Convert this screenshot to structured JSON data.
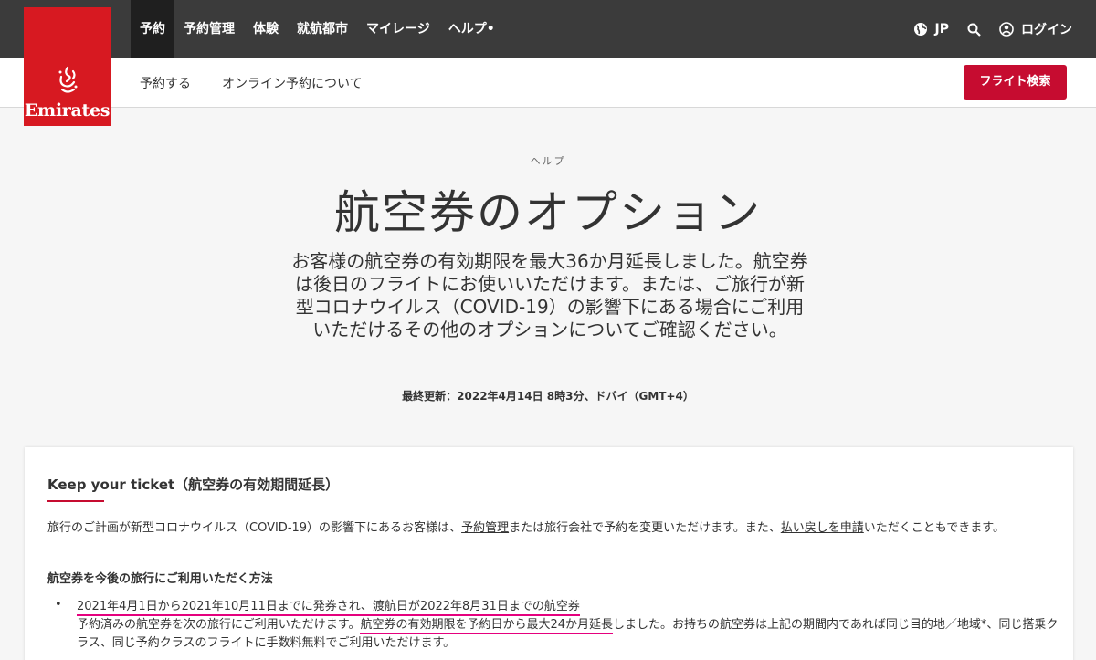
{
  "brand": {
    "name": "Emirates",
    "color": "#d71921"
  },
  "topnav": {
    "items": [
      {
        "label": "予約",
        "active": true
      },
      {
        "label": "予約管理"
      },
      {
        "label": "体験"
      },
      {
        "label": "就航都市"
      },
      {
        "label": "マイレージ"
      },
      {
        "label": "ヘルプ•"
      }
    ],
    "region": "JP",
    "login": "ログイン"
  },
  "subnav": {
    "links": [
      "予約する",
      "オンライン予約について"
    ],
    "search_button": "フライト検索"
  },
  "hero": {
    "eyebrow": "ヘルプ",
    "title": "航空券のオプション",
    "lead": "お客様の航空券の有効期限を最大36か月延長しました。航空券は後日のフライトにお使いいただけます。または、ご旅行が新型コロナウイルス（COVID-19）の影響下にある場合にご利用いただけるその他のオプションについてご確認ください。",
    "updated": "最終更新：2022年4月14日 8時3分、ドバイ（GMT+4）"
  },
  "card": {
    "title": "Keep your ticket（航空券の有効期間延長）",
    "para": {
      "t1": "旅行のご計画が新型コロナウイルス（COVID-19）の影響下にあるお客様は、",
      "link1": "予約管理",
      "t2": "または旅行会社で予約を変更いただけます。また、",
      "link2": "払い戻しを申請",
      "t3": "いただくこともできます。"
    },
    "subhead": "航空券を今後の旅行にご利用いただく方法",
    "item": {
      "bullet": "•",
      "title": "2021年4月1日から2021年10月11日までに発券され、渡航日が2022年8月31日までの航空券",
      "body_pre": "予約済みの航空券を次の旅行にご利用いただけます。",
      "body_hl": "航空券の有効期限を予約日から最大24か月延長",
      "body_post": "しました。お持ちの航空券は上記の期間内であれば同じ目的地／地域*、同じ搭乗クラス、同じ予約クラスのフライトに手数料無料でご利用いただけます。"
    }
  },
  "colors": {
    "accent": "#c60c30",
    "highlight": "#e5007e",
    "topbar": "#3b3b3b"
  }
}
